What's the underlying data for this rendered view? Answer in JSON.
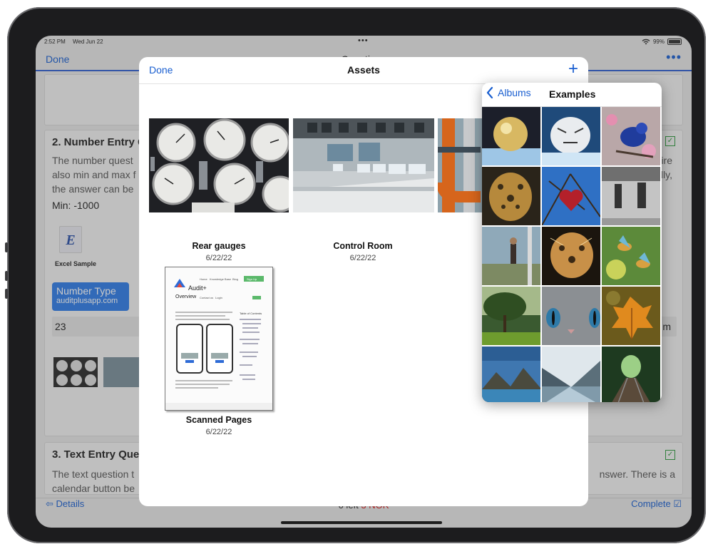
{
  "status": {
    "time": "2:52 PM",
    "date": "Wed Jun 22",
    "battery": "99%"
  },
  "topnav": {
    "done": "Done",
    "title": "Questions"
  },
  "card2": {
    "title": "2. Number Entry Q",
    "desc": [
      "The number quest",
      "also min and max f",
      "the answer can be"
    ],
    "min": "Min: -1000",
    "excel_label": "Excel Sample",
    "number_type": "Number Type",
    "number_url": "auditplusapp.com",
    "value": "23",
    "right_fragments": [
      "ire",
      "ally,",
      "m"
    ]
  },
  "card3": {
    "title": "3. Text Entry Ques",
    "desc": [
      "The text question t",
      "calendar button be"
    ],
    "right_fragment": "nswer.  There is a"
  },
  "bottombar": {
    "details": "Details",
    "count": "0 left ",
    "nok": "3 NOK",
    "complete": "Complete"
  },
  "assets": {
    "done": "Done",
    "title": "Assets",
    "items": [
      {
        "name": "Rear gauges",
        "date": "6/22/22"
      },
      {
        "name": "Control Room",
        "date": "6/22/22"
      },
      {
        "name": "Scanned Pages",
        "date": "6/22/22"
      }
    ]
  },
  "scan": {
    "brand": "Audit+",
    "nav": [
      "Home",
      "Knowledge Base",
      "Blog",
      "Sign Up"
    ],
    "heading": "Overview",
    "links": [
      "Contact us",
      "Login"
    ],
    "toc": "Table of Contents"
  },
  "popover": {
    "back": "Albums",
    "title": "Examples",
    "photos": [
      "bubble",
      "tiger",
      "blue-bird",
      "leopard",
      "heart",
      "jumpers",
      "climber",
      "leopard-art",
      "hummingbirds",
      "tree",
      "cat-eyes",
      "leaf",
      "lake",
      "fjord",
      "railway"
    ]
  },
  "colors": {
    "accent": "#1a5fd0",
    "nok": "#d01818",
    "check": "#2e9a3e"
  }
}
